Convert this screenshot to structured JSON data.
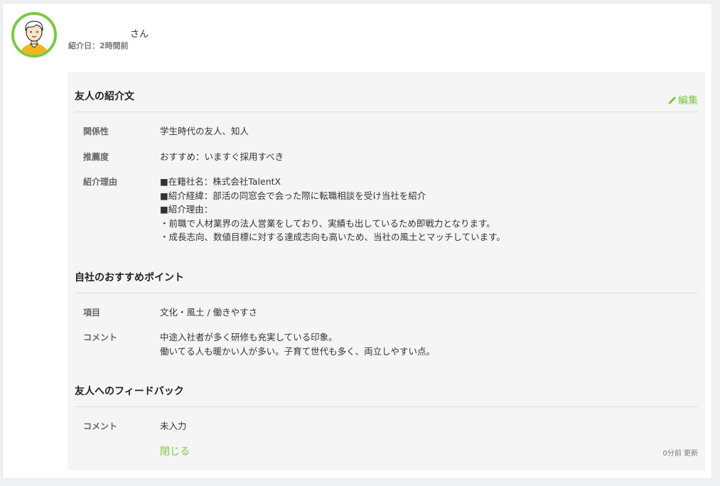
{
  "header": {
    "name_suffix": "さん",
    "intro_date": "紹介日：2時間前"
  },
  "referral": {
    "title": "友人の紹介文",
    "edit_label": "編集",
    "rows": [
      {
        "label": "関係性",
        "lines": [
          "学生時代の友人、知人"
        ]
      },
      {
        "label": "推薦度",
        "lines": [
          "おすすめ：いますぐ採用すべき"
        ]
      },
      {
        "label": "紹介理由",
        "lines": [
          "■在籍社名：株式会社TalentX",
          "■紹介経緯：部活の同窓会で会った際に転職相談を受け当社を紹介",
          "■紹介理由：",
          "・前職で人材業界の法人営業をしており、実績も出しているため即戦力となります。",
          "・成長志向、数値目標に対する達成志向も高いため、当社の風土とマッチしています。"
        ]
      }
    ]
  },
  "points": {
    "title": "自社のおすすめポイント",
    "rows": [
      {
        "label": "項目",
        "lines": [
          "文化・風土 / 働きやすさ"
        ]
      },
      {
        "label": "コメント",
        "lines": [
          "中途入社者が多く研修も充実している印象。",
          "働いてる人も暖かい人が多い。子育て世代も多く、両立しやすい点。"
        ]
      }
    ]
  },
  "feedback": {
    "title": "友人へのフィードバック",
    "rows": [
      {
        "label": "コメント",
        "lines": [
          "未入力"
        ]
      }
    ],
    "close_label": "閉じる",
    "updated": "0分前 更新"
  },
  "colors": {
    "accent": "#7ac943",
    "panel_bg": "#f5f5f5"
  },
  "icons": {
    "avatar": "person-avatar-icon",
    "edit": "pencil-icon"
  }
}
